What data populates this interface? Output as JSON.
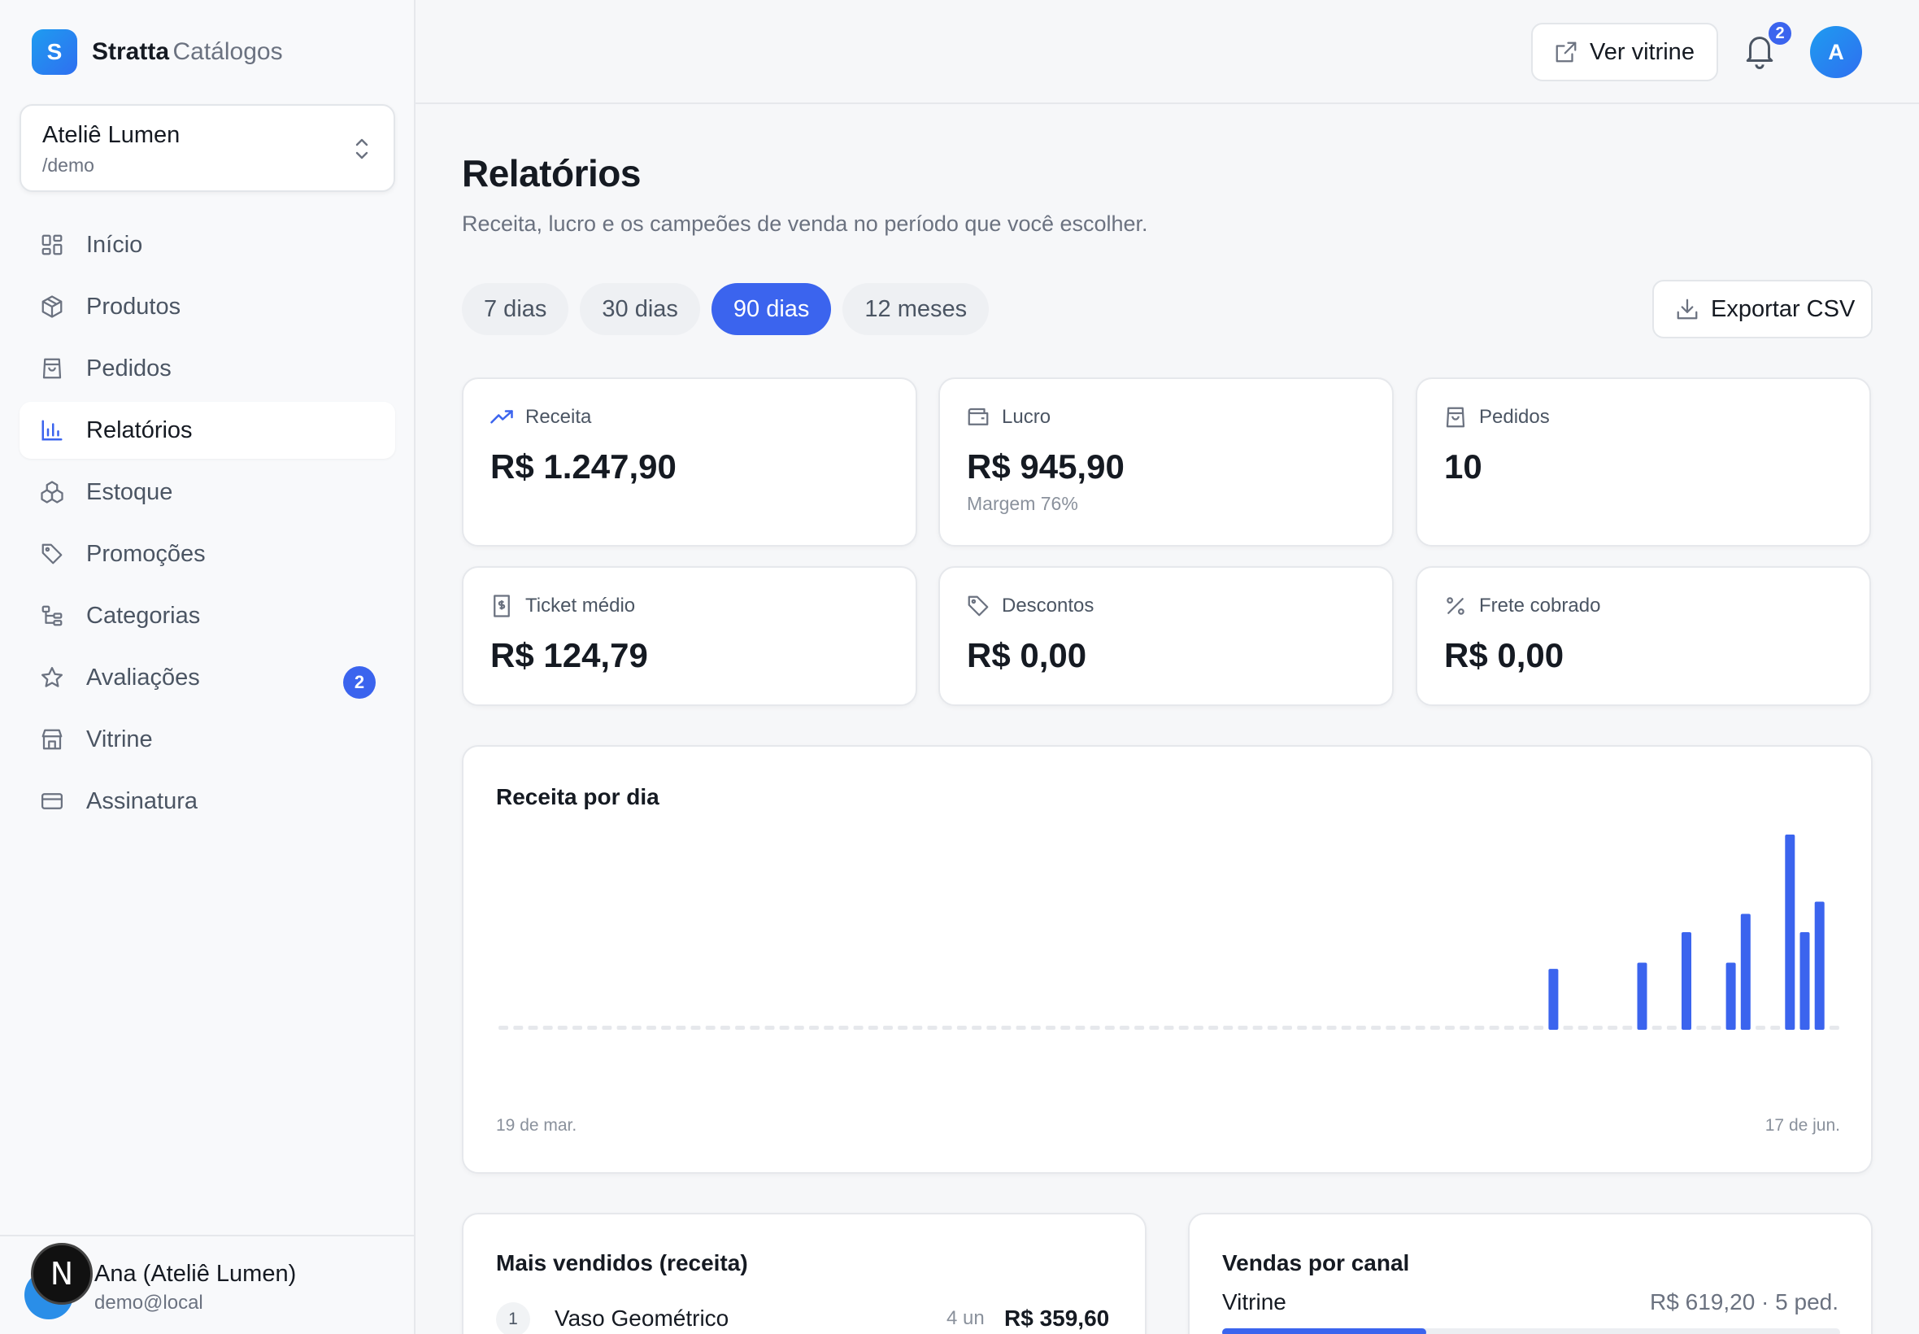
{
  "brand": {
    "name": "Stratta",
    "suffix": "Catálogos",
    "logo_letter": "S"
  },
  "store": {
    "name": "Ateliê Lumen",
    "slug": "/demo"
  },
  "sidebar": {
    "items": [
      {
        "label": "Início",
        "icon": "grid-icon"
      },
      {
        "label": "Produtos",
        "icon": "box-icon"
      },
      {
        "label": "Pedidos",
        "icon": "shopping-bag-icon"
      },
      {
        "label": "Relatórios",
        "icon": "bar-chart-icon",
        "active": true
      },
      {
        "label": "Estoque",
        "icon": "boxes-icon"
      },
      {
        "label": "Promoções",
        "icon": "tag-icon"
      },
      {
        "label": "Categorias",
        "icon": "tree-icon"
      },
      {
        "label": "Avaliações",
        "icon": "star-icon",
        "badge": "2"
      },
      {
        "label": "Vitrine",
        "icon": "store-icon"
      },
      {
        "label": "Assinatura",
        "icon": "credit-card-icon"
      }
    ]
  },
  "user": {
    "name": "Ana (Ateliê Lumen)",
    "email": "demo@local",
    "next_badge": "N"
  },
  "topbar": {
    "ver_vitrine": "Ver vitrine",
    "notifications": "2",
    "avatar_letter": "A"
  },
  "page": {
    "title": "Relatórios",
    "subtitle": "Receita, lucro e os campeões de venda no período que você escolher."
  },
  "periods": [
    {
      "label": "7 dias"
    },
    {
      "label": "30 dias"
    },
    {
      "label": "90 dias",
      "active": true
    },
    {
      "label": "12 meses"
    }
  ],
  "export_label": "Exportar CSV",
  "kpis": [
    {
      "label": "Receita",
      "value": "R$ 1.247,90",
      "icon": "trending-up-icon"
    },
    {
      "label": "Lucro",
      "value": "R$ 945,90",
      "note": "Margem 76%",
      "icon": "wallet-icon"
    },
    {
      "label": "Pedidos",
      "value": "10",
      "icon": "shopping-bag-icon"
    },
    {
      "label": "Ticket médio",
      "value": "R$ 124,79",
      "icon": "receipt-icon"
    },
    {
      "label": "Descontos",
      "value": "R$ 0,00",
      "icon": "tag-icon"
    },
    {
      "label": "Frete cobrado",
      "value": "R$ 0,00",
      "icon": "percent-icon"
    }
  ],
  "chart_data": {
    "type": "bar",
    "title": "Receita por dia",
    "x_start_label": "19 de mar.",
    "x_end_label": "17 de jun.",
    "color": "#3b64ee",
    "values": [
      0,
      0,
      0,
      0,
      0,
      0,
      0,
      0,
      0,
      0,
      0,
      0,
      0,
      0,
      0,
      0,
      0,
      0,
      0,
      0,
      0,
      0,
      0,
      0,
      0,
      0,
      0,
      0,
      0,
      0,
      0,
      0,
      0,
      0,
      0,
      0,
      0,
      0,
      0,
      0,
      0,
      0,
      0,
      0,
      0,
      0,
      0,
      0,
      0,
      0,
      0,
      0,
      0,
      0,
      0,
      0,
      0,
      0,
      0,
      0,
      0,
      0,
      0,
      0,
      0,
      0,
      0,
      0,
      0,
      0,
      0,
      99.9,
      0,
      0,
      0,
      0,
      0,
      109.9,
      0,
      0,
      159.9,
      0,
      0,
      109.9,
      189.9,
      0,
      0,
      319.9,
      159.9,
      209.9,
      0
    ]
  },
  "top_sellers": {
    "title": "Mais vendidos (receita)",
    "items": [
      {
        "rank": "1",
        "name": "Vaso Geométrico",
        "qty": "4 un",
        "revenue": "R$ 359,60"
      }
    ]
  },
  "channels": {
    "title": "Vendas por canal",
    "items": [
      {
        "name": "Vitrine",
        "value": "R$ 619,20 · 5 ped.",
        "share": 0.33
      }
    ]
  }
}
